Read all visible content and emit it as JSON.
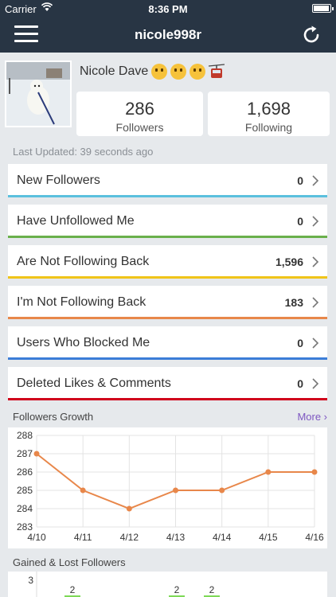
{
  "status_bar": {
    "carrier": "Carrier",
    "time": "8:36 PM",
    "battery_level": 0.95
  },
  "nav": {
    "title": "nicole998r"
  },
  "profile": {
    "name": "Nicole Dave",
    "emojis": [
      "grinning-face",
      "winking-face",
      "squinting-face",
      "aerial-tramway"
    ]
  },
  "stats": {
    "followers": {
      "value": "286",
      "label": "Followers"
    },
    "following": {
      "value": "1,698",
      "label": "Following"
    }
  },
  "last_updated": "Last Updated: 39 seconds ago",
  "rows": [
    {
      "label": "New Followers",
      "count": "0",
      "color": "#5bc0de"
    },
    {
      "label": "Have Unfollowed Me",
      "count": "0",
      "color": "#6ab04c"
    },
    {
      "label": "Are Not Following Back",
      "count": "1,596",
      "color": "#f0c419"
    },
    {
      "label": "I'm Not Following Back",
      "count": "183",
      "color": "#e8874a"
    },
    {
      "label": "Users Who Blocked Me",
      "count": "0",
      "color": "#3b7dd8"
    },
    {
      "label": "Deleted Likes & Comments",
      "count": "0",
      "color": "#d0021b"
    }
  ],
  "growth": {
    "title": "Followers Growth",
    "more": "More ›"
  },
  "gained_lost": {
    "title": "Gained & Lost Followers",
    "y_top_label": "3",
    "bar_labels": [
      "2",
      "2",
      "2"
    ]
  },
  "chart_data": {
    "type": "line",
    "title": "Followers Growth",
    "x": [
      "4/10",
      "4/11",
      "4/12",
      "4/13",
      "4/14",
      "4/15",
      "4/16"
    ],
    "series": [
      {
        "values": [
          287,
          285,
          284,
          285,
          285,
          286,
          286
        ]
      }
    ],
    "ylim": [
      283,
      288
    ],
    "yticks": [
      283,
      284,
      285,
      286,
      287,
      288
    ],
    "grid": true,
    "line_color": "#e8874a"
  }
}
